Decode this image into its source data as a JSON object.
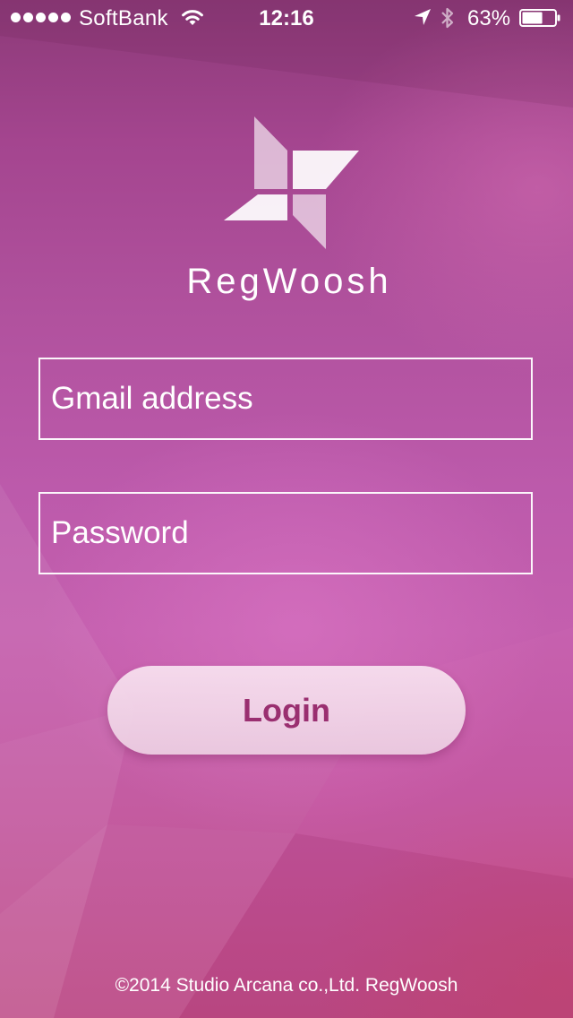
{
  "status_bar": {
    "carrier": "SoftBank",
    "time": "12:16",
    "battery_percent": "63%",
    "battery_level": 0.63,
    "signal_bars": 5,
    "icons": [
      "wifi-icon",
      "location-arrow-icon",
      "bluetooth-icon",
      "battery-icon"
    ]
  },
  "brand": {
    "name": "RegWoosh",
    "logo_icon": "pinwheel-logo"
  },
  "form": {
    "email_placeholder": "Gmail address",
    "email_value": "",
    "password_placeholder": "Password",
    "password_value": "",
    "login_label": "Login"
  },
  "footer": {
    "copyright": "©2014 Studio Arcana co.,Ltd. RegWoosh"
  },
  "colors": {
    "background_top": "#8c3a78",
    "background_mid": "#c45fae",
    "background_bottom": "#bd4b86",
    "button_text": "#9a2f70",
    "button_fill": "#f3dcec",
    "foreground": "#ffffff"
  }
}
